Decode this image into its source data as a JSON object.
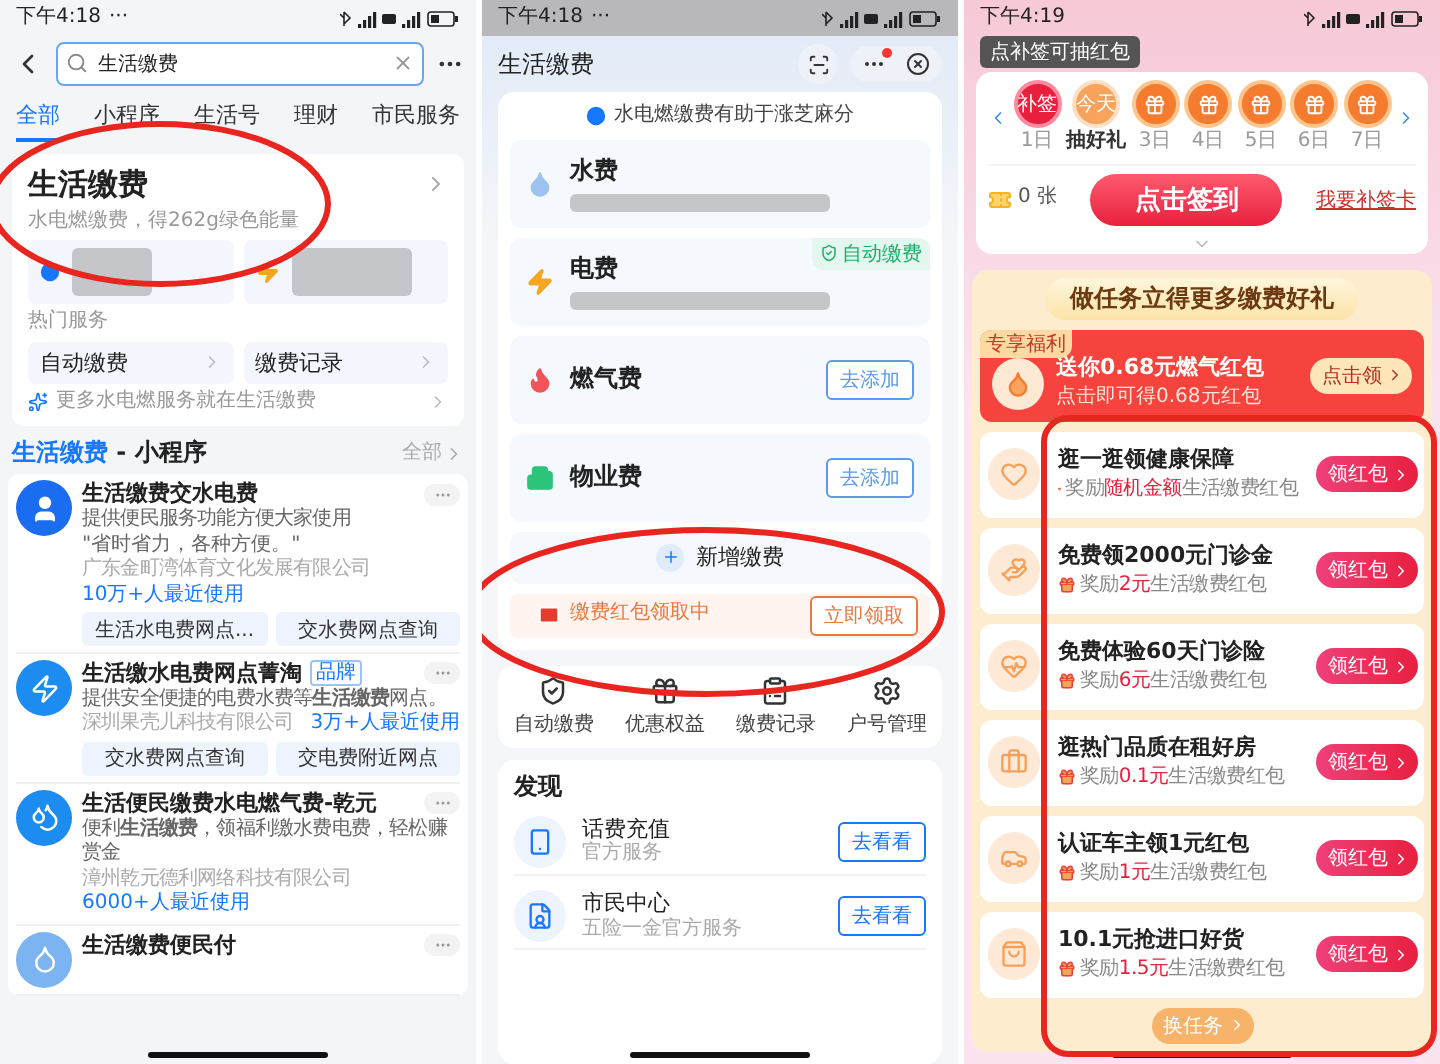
{
  "search_screen": {
    "status_time": "下午4:18",
    "status_more": "···",
    "search": {
      "value": "生活缴费"
    },
    "tabs": [
      {
        "label": "全部",
        "selected": true
      },
      {
        "label": "小程序",
        "selected": false
      },
      {
        "label": "生活号",
        "selected": false
      },
      {
        "label": "理财",
        "selected": false
      },
      {
        "label": "市民服务",
        "selected": false
      }
    ],
    "service_card": {
      "title": "生活缴费",
      "subtitle": "水电燃缴费，得262g绿色能量",
      "section": "热门服务",
      "services": [
        "自动缴费",
        "缴费记录"
      ],
      "footer": "更多水电燃服务就在生活缴费"
    },
    "mini_programs": {
      "title": "生活缴费",
      "suffix": " - 小程序",
      "more": "全部"
    },
    "apps": [
      {
        "name": "生活缴费交水电费",
        "desc": "提供便民服务功能方便大家使用",
        "quote": "\"省时省力，各种方便。\"",
        "company": "广东金町湾体育文化发展有限公司",
        "users": "10万+人最近使用",
        "actions": [
          "生活水电费网点...",
          "交水费网点查询"
        ]
      },
      {
        "name": "生活缴水电费网点菁淘",
        "badge": "品牌",
        "desc": "提供安全便捷的电费水费等**生活缴费**网点。",
        "company": "深圳果壳儿科技有限公司",
        "users": "3万+人最近使用",
        "actions": [
          "交水费网点查询",
          "交电费附近网点"
        ]
      },
      {
        "name": "生活便民缴费水电燃气费-乾元",
        "desc": "便利**生活缴费**，领福利缴水费电费，轻松赚赏金",
        "company": "漳州乾元德利网络科技有限公司",
        "users": "6000+人最近使用"
      },
      {
        "name": "生活缴费便民付"
      }
    ]
  },
  "bills_screen": {
    "status_time": "下午4:18",
    "status_more": "···",
    "title": "生活缴费",
    "notice": "水电燃缴费有助于涨芝麻分",
    "bills": [
      {
        "name": "水费",
        "redacted": true
      },
      {
        "name": "电费",
        "redacted": true,
        "auto_tag": "自动缴费"
      },
      {
        "name": "燃气费",
        "redacted": false,
        "button": "去添加"
      },
      {
        "name": "物业费",
        "redacted": false,
        "button": "去添加"
      }
    ],
    "add_label": "新增缴费",
    "promo": {
      "text": "缴费红包领取中",
      "button": "立即领取"
    },
    "shortcuts": [
      "自动缴费",
      "优惠权益",
      "缴费记录",
      "户号管理"
    ],
    "discover": {
      "title": "发现",
      "items": [
        {
          "name": "话费充值",
          "sub": "官方服务",
          "button": "去看看"
        },
        {
          "name": "市民中心",
          "sub": "五险一金官方服务",
          "button": "去看看"
        }
      ]
    }
  },
  "checkin_screen": {
    "status_time": "下午4:19",
    "tooltip": "点补签可抽红包",
    "days": [
      {
        "kind": "makeup",
        "badge": "补签",
        "label": "1日"
      },
      {
        "kind": "today",
        "badge": "今天",
        "label": "抽好礼"
      },
      {
        "kind": "gift",
        "label": "3日"
      },
      {
        "kind": "gift",
        "label": "4日"
      },
      {
        "kind": "gift",
        "label": "5日"
      },
      {
        "kind": "gift",
        "label": "6日"
      },
      {
        "kind": "gift",
        "label": "7日"
      }
    ],
    "cards": "0 张",
    "sign_button": "点击签到",
    "makeup_link": "我要补签卡",
    "board_title": "做任务立得更多缴费好礼",
    "featured": {
      "tag": "专享福利",
      "title": "送你0.68元燃气红包",
      "sub": "点击即可得0.68元红包",
      "button": "点击领"
    },
    "tasks": [
      {
        "title": "逛一逛领健康保障",
        "reward_label": "奖励",
        "amount": "随机金额",
        "reward_text": "生活缴费红包",
        "button": "领红包"
      },
      {
        "title": "免费领2000元门诊金",
        "reward_label": "奖励",
        "amount": "2元",
        "reward_text": "生活缴费红包",
        "button": "领红包"
      },
      {
        "title": "免费体验60天门诊险",
        "reward_label": "奖励",
        "amount": "6元",
        "reward_text": "生活缴费红包",
        "button": "领红包"
      },
      {
        "title": "逛热门品质在租好房",
        "reward_label": "奖励",
        "amount": "0.1元",
        "reward_text": "生活缴费红包",
        "button": "领红包"
      },
      {
        "title": "认证车主领1元红包",
        "reward_label": "奖励",
        "amount": "1元",
        "reward_text": "生活缴费红包",
        "button": "领红包"
      },
      {
        "title": "10.1元抢进口好货",
        "reward_label": "奖励",
        "amount": "1.5元",
        "reward_text": "生活缴费红包",
        "button": "领红包"
      }
    ],
    "more_button": "换任务"
  }
}
